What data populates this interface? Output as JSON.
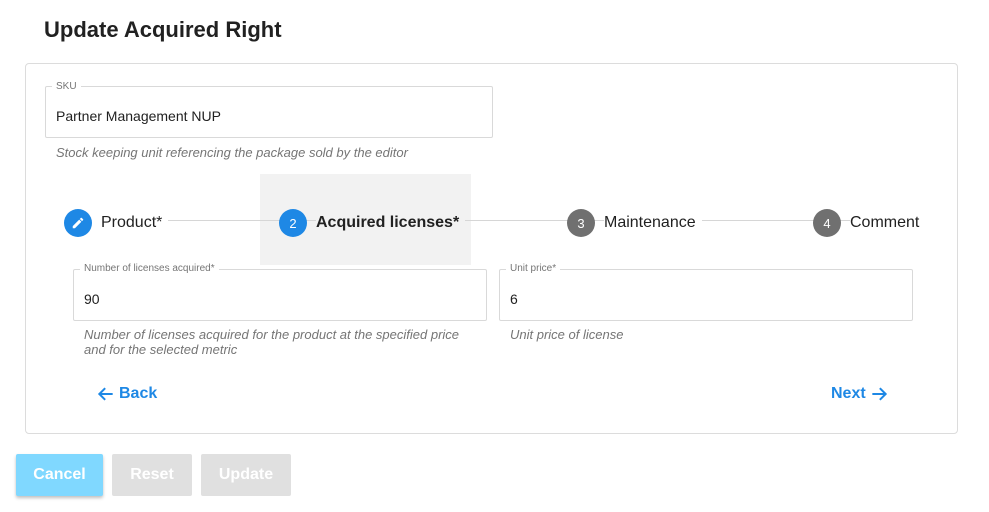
{
  "page": {
    "title": "Update Acquired Right"
  },
  "sku": {
    "label": "SKU",
    "value": "Partner Management NUP",
    "hint": "Stock keeping unit referencing the package sold by the editor"
  },
  "stepper": {
    "steps": [
      {
        "number": "1",
        "label": "Product*",
        "state": "completed",
        "icon": "pencil-icon"
      },
      {
        "number": "2",
        "label": "Acquired licenses*",
        "state": "active"
      },
      {
        "number": "3",
        "label": "Maintenance",
        "state": "pending"
      },
      {
        "number": "4",
        "label": "Comment",
        "state": "pending"
      }
    ]
  },
  "licenses": {
    "label": "Number of licenses acquired*",
    "value": "90",
    "hint": "Number of licenses acquired for the product at the specified price and for the selected metric"
  },
  "unit_price": {
    "label": "Unit price*",
    "value": "6",
    "hint": "Unit price of license"
  },
  "nav": {
    "back_label": "Back",
    "next_label": "Next"
  },
  "actions": {
    "cancel_label": "Cancel",
    "reset_label": "Reset",
    "update_label": "Update"
  },
  "colors": {
    "accent": "#1e88e5",
    "cancel_bg": "#80d8ff",
    "disabled_bg": "#e0e0e0",
    "step_inactive": "#707070"
  }
}
